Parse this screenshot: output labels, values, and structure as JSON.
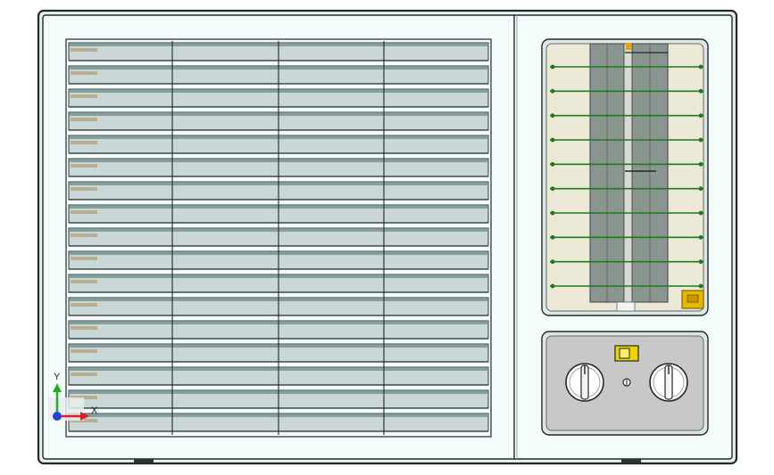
{
  "view": {
    "background": "#ffffff",
    "body_fill": "#f3fbfb",
    "outline": "#1f2a2a",
    "grille_slat_fill": "#c9d7d7",
    "grille_shadow": "#7d9898",
    "coil_fill": "#ebe9d6",
    "fin_fill": "#8a9590",
    "fin_rod": "#1f7a1f",
    "control_panel_fill": "#c8c8c8",
    "accent_yellow": "#f2d200"
  },
  "grille": {
    "slat_count": 17
  },
  "coil": {
    "rod_count": 10
  },
  "controls": {
    "knobs": [
      "left-knob",
      "right-knob"
    ],
    "switch": "rocker-switch"
  },
  "triad": {
    "y_label": "Y",
    "x_label": "X",
    "y_color": "#20b020",
    "x_color": "#e02020",
    "z_color": "#2040e0"
  }
}
